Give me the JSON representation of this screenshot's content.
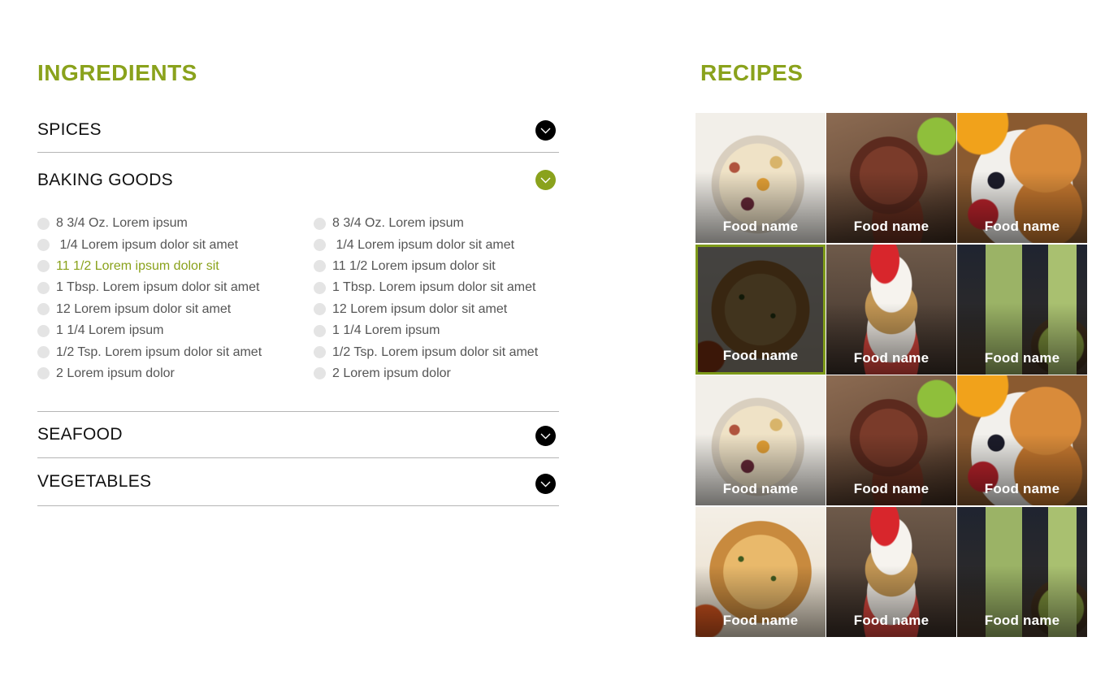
{
  "ingredients": {
    "title": "INGREDIENTS",
    "sections": [
      {
        "label": "SPICES",
        "open": false
      },
      {
        "label": "BAKING GOODS",
        "open": true
      },
      {
        "label": "SEAFOOD",
        "open": false
      },
      {
        "label": "VEGETABLES",
        "open": false
      }
    ],
    "baking_goods_items": {
      "left": [
        "8 3/4 Oz. Lorem ipsum",
        " 1/4 Lorem ipsum dolor sit amet",
        "11 1/2 Lorem ipsum dolor sit",
        "1 Tbsp. Lorem ipsum dolor sit amet",
        "12 Lorem ipsum dolor sit amet",
        "1 1/4 Lorem ipsum",
        "1/2 Tsp. Lorem ipsum dolor sit amet",
        "2 Lorem ipsum dolor"
      ],
      "right": [
        "8 3/4 Oz. Lorem ipsum",
        " 1/4 Lorem ipsum dolor sit amet",
        "11 1/2 Lorem ipsum dolor sit",
        "1 Tbsp. Lorem ipsum dolor sit amet",
        "12 Lorem ipsum dolor sit amet",
        "1 1/4 Lorem ipsum",
        "1/2 Tsp. Lorem ipsum dolor sit amet",
        "2 Lorem ipsum dolor"
      ],
      "highlighted_left_index": 2
    }
  },
  "recipes": {
    "title": "RECIPES",
    "tiles": [
      {
        "label": "Food name",
        "image": "grain-bowl"
      },
      {
        "label": "Food name",
        "image": "steak"
      },
      {
        "label": "Food name",
        "image": "croissant-breakfast"
      },
      {
        "label": "Food name",
        "image": "roast-chicken",
        "selected": true
      },
      {
        "label": "Food name",
        "image": "yogurt-parfait"
      },
      {
        "label": "Food name",
        "image": "green-smoothie"
      },
      {
        "label": "Food name",
        "image": "grain-bowl"
      },
      {
        "label": "Food name",
        "image": "steak"
      },
      {
        "label": "Food name",
        "image": "croissant-breakfast"
      },
      {
        "label": "Food name",
        "image": "roast-chicken"
      },
      {
        "label": "Food name",
        "image": "yogurt-parfait"
      },
      {
        "label": "Food name",
        "image": "green-smoothie"
      }
    ]
  },
  "colors": {
    "accent": "#8aa21c",
    "selected_border": "#7e9a1a",
    "toggle_closed": "#000000",
    "divider": "#b5b5b5",
    "item_text": "#555555"
  },
  "icons": {
    "toggle": "chevron-down-icon",
    "item_marker": "circle-checkbox-icon"
  }
}
